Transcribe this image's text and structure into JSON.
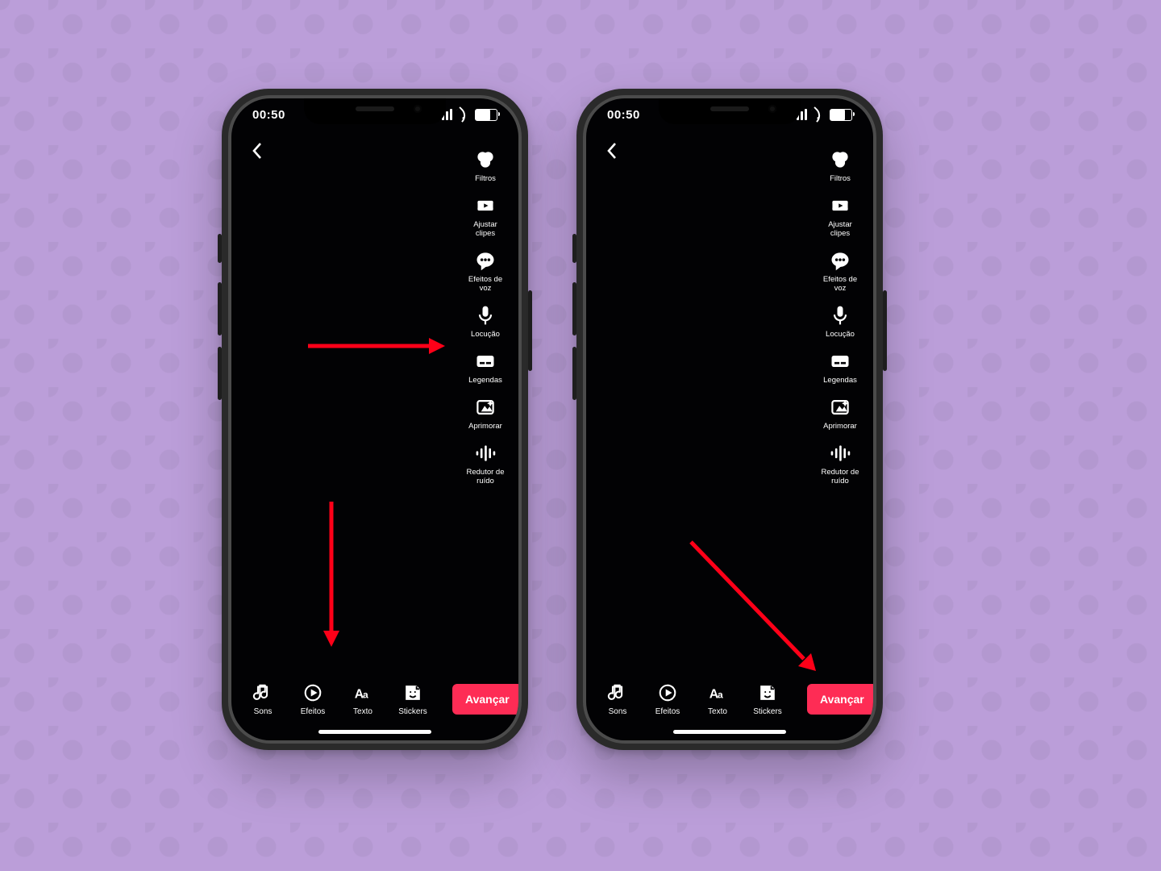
{
  "status": {
    "time": "00:50"
  },
  "topbar": {
    "back_name": "back-button"
  },
  "side_tools": [
    {
      "id": "filtros",
      "label": "Filtros",
      "icon": "filters-icon"
    },
    {
      "id": "ajustar",
      "label": "Ajustar\nclipes",
      "icon": "adjust-clips-icon"
    },
    {
      "id": "efeitosvoz",
      "label": "Efeitos de\nvoz",
      "icon": "voice-effects-icon"
    },
    {
      "id": "locucao",
      "label": "Locução",
      "icon": "microphone-icon"
    },
    {
      "id": "legendas",
      "label": "Legendas",
      "icon": "captions-icon"
    },
    {
      "id": "aprimorar",
      "label": "Aprimorar",
      "icon": "enhance-icon"
    },
    {
      "id": "redutor",
      "label": "Redutor de\nruído",
      "icon": "noise-reduce-icon"
    }
  ],
  "bottom_tools": [
    {
      "id": "sons",
      "label": "Sons",
      "icon": "music-icon"
    },
    {
      "id": "efeitos",
      "label": "Efeitos",
      "icon": "effects-icon"
    },
    {
      "id": "texto",
      "label": "Texto",
      "icon": "text-icon"
    },
    {
      "id": "stickers",
      "label": "Stickers",
      "icon": "stickers-icon"
    }
  ],
  "next_button": {
    "label": "Avançar"
  },
  "colors": {
    "accent": "#fe2c55",
    "annotation": "#ff0018"
  },
  "annotations": {
    "phone_left": [
      {
        "type": "arrow-right",
        "desc": "points to Locução"
      },
      {
        "type": "arrow-down",
        "desc": "points to bottom toolbar"
      }
    ],
    "phone_right": [
      {
        "type": "arrow-diag-down-right",
        "desc": "points to Avançar"
      }
    ]
  }
}
